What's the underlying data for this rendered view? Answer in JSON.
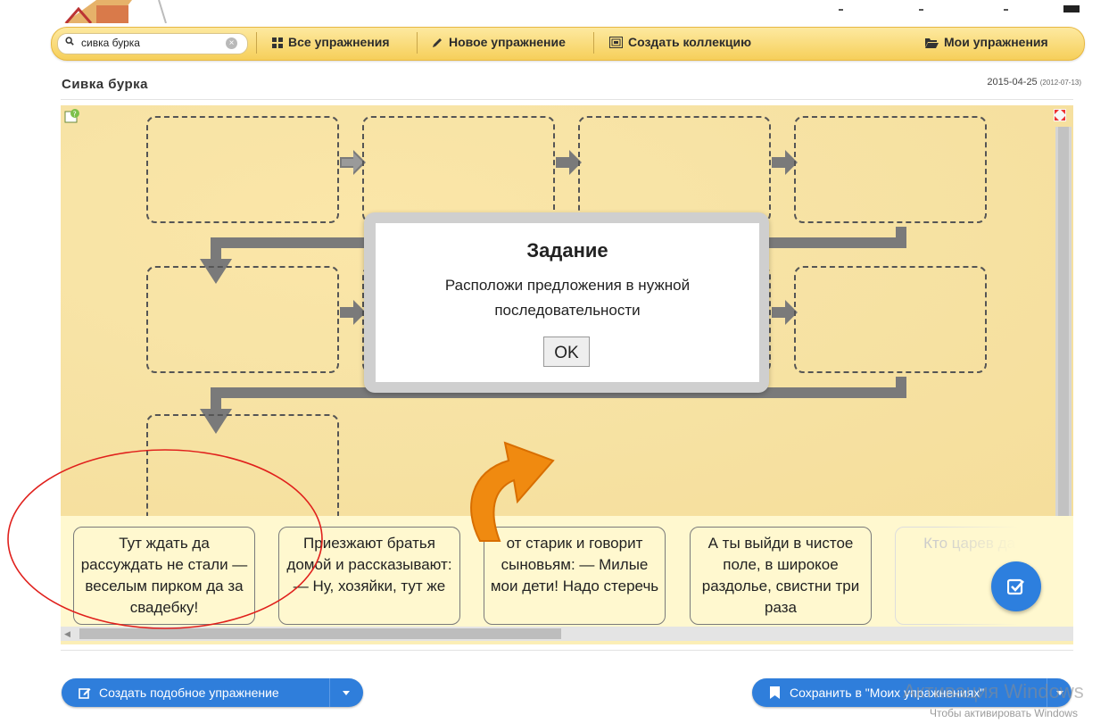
{
  "nav": {
    "search_value": "сивка бурка",
    "all_exercises": "Все упражнения",
    "new_exercise": "Новое упражнение",
    "create_collection": "Создать коллекцию",
    "my_exercises": "Мои упражнения"
  },
  "page": {
    "title": "Сивка бурка",
    "date": "2015-04-25",
    "date_created": "(2012-07-13)"
  },
  "modal": {
    "title": "Задание",
    "text": "Расположи предложения в нужной последовательности",
    "ok": "OK"
  },
  "cards": [
    "Тут ждать да рассуждать не стали — веселым пирком да за свадебку!",
    "Приезжают братья домой и рассказывают: — Ну, хозяйки, тут же",
    "от старик и говорит сыновьям: — Милые мои дети! Надо стеречь",
    "А ты выйди в чистое поле, в широкое раздолье, свистни три раза",
    "Кто царев да с ее"
  ],
  "buttons": {
    "create_similar": "Создать подобное упражнение",
    "save_mine": "Сохранить в \"Моих упражнениях\""
  },
  "watermark": {
    "line1": "Активация Windows",
    "line2": "Чтобы активировать Windows"
  },
  "colors": {
    "navbar": "#f6cf5a",
    "board": "#fbeeb6",
    "button_blue": "#2f7edb",
    "annotation_red": "#e0201c",
    "arrow_orange": "#f08a10"
  }
}
